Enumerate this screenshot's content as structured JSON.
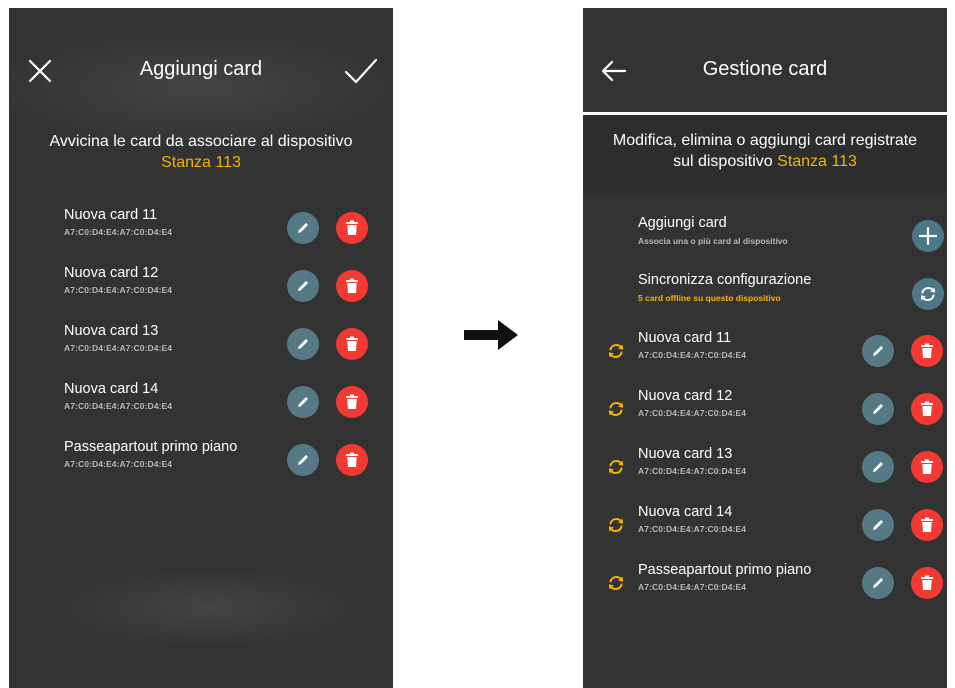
{
  "left_screen": {
    "title": "Aggiungi card",
    "instruction": "Avvicina le card da associare al dispositivo",
    "device_name": "Stanza 113",
    "cards": [
      {
        "name": "Nuova card 11",
        "code": "A7:C0:D4:E4:A7:C0:D4:E4"
      },
      {
        "name": "Nuova card 12",
        "code": "A7:C0:D4:E4:A7:C0:D4:E4"
      },
      {
        "name": "Nuova card 13",
        "code": "A7:C0:D4:E4:A7:C0:D4:E4"
      },
      {
        "name": "Nuova card 14",
        "code": "A7:C0:D4:E4:A7:C0:D4:E4"
      },
      {
        "name": "Passeapartout primo piano",
        "code": "A7:C0:D4:E4:A7:C0:D4:E4"
      }
    ]
  },
  "right_screen": {
    "title": "Gestione card",
    "description_line1": "Modifica, elimina o aggiungi card registrate",
    "description_line2_prefix": "sul dispositivo",
    "device_name": "Stanza 113",
    "actions": {
      "add": {
        "title": "Aggiungi card",
        "subtitle": "Associa una o più card al dispositivo"
      },
      "sync": {
        "title": "Sincronizza configurazione",
        "subtitle": "5 card offline su questo dispositivo"
      }
    },
    "cards": [
      {
        "name": "Nuova card 11",
        "code": "A7:C0:D4:E4:A7:C0:D4:E4"
      },
      {
        "name": "Nuova card 12",
        "code": "A7:C0:D4:E4:A7:C0:D4:E4"
      },
      {
        "name": "Nuova card 13",
        "code": "A7:C0:D4:E4:A7:C0:D4:E4"
      },
      {
        "name": "Nuova card 14",
        "code": "A7:C0:D4:E4:A7:C0:D4:E4"
      },
      {
        "name": "Passeapartout primo piano",
        "code": "A7:C0:D4:E4:A7:C0:D4:E4"
      }
    ]
  },
  "icons": {
    "close": "close-icon",
    "confirm": "check-icon",
    "back": "arrow-left-icon",
    "edit": "pencil-icon",
    "delete": "trash-icon",
    "add": "plus-icon",
    "sync": "sync-icon",
    "transition": "arrow-right-icon"
  },
  "colors": {
    "background": "#333333",
    "accent": "#f4b400",
    "edit_button": "#557985",
    "delete_button": "#f23a33",
    "code_text": "#b9b9b9"
  }
}
